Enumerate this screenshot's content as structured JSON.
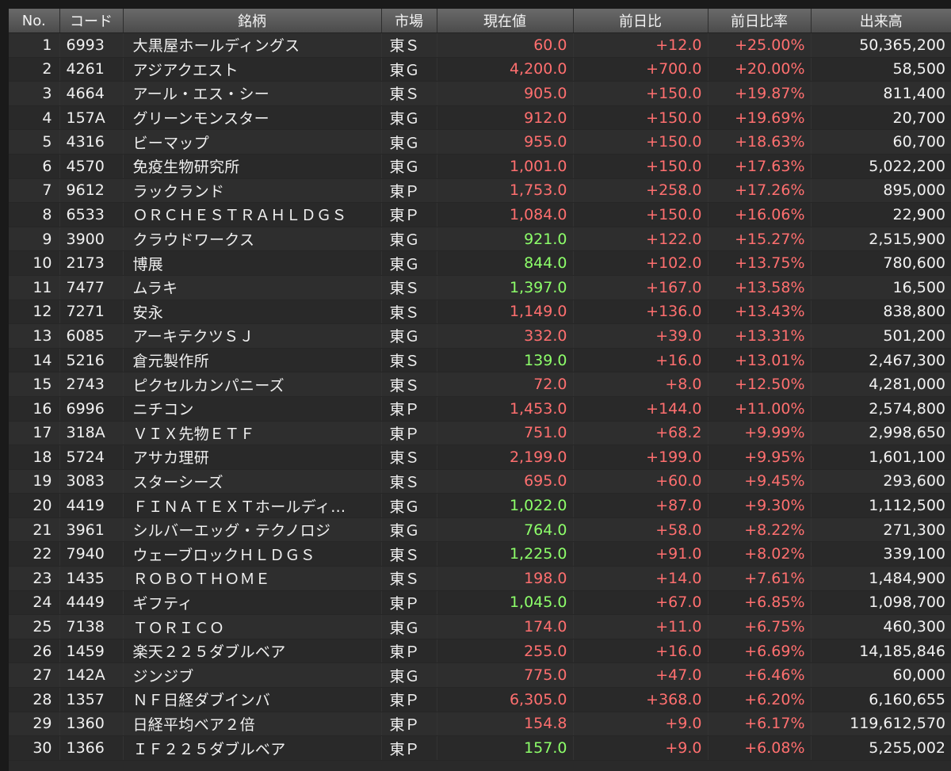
{
  "colors": {
    "up": "#ff6f6f",
    "highlight_up": "#8dff6a",
    "text": "#f0f0f0",
    "header_bg": "#5a5a5a"
  },
  "headers": {
    "no": "No.",
    "code": "コード",
    "name": "銘柄",
    "market": "市場",
    "price": "現在値",
    "change": "前日比",
    "rate": "前日比率",
    "volume": "出来高"
  },
  "rows": [
    {
      "no": "1",
      "code": "6993",
      "name": "大黒屋ホールディングス",
      "market": "東Ｓ",
      "price": "60.0",
      "price_color": "red",
      "change": "+12.0",
      "rate": "+25.00%",
      "volume": "50,365,200"
    },
    {
      "no": "2",
      "code": "4261",
      "name": "アジアクエスト",
      "market": "東Ｇ",
      "price": "4,200.0",
      "price_color": "red",
      "change": "+700.0",
      "rate": "+20.00%",
      "volume": "58,500"
    },
    {
      "no": "3",
      "code": "4664",
      "name": "アール・エス・シー",
      "market": "東Ｓ",
      "price": "905.0",
      "price_color": "red",
      "change": "+150.0",
      "rate": "+19.87%",
      "volume": "811,400"
    },
    {
      "no": "4",
      "code": "157A",
      "name": "グリーンモンスター",
      "market": "東Ｇ",
      "price": "912.0",
      "price_color": "red",
      "change": "+150.0",
      "rate": "+19.69%",
      "volume": "20,700"
    },
    {
      "no": "5",
      "code": "4316",
      "name": "ビーマップ",
      "market": "東Ｇ",
      "price": "955.0",
      "price_color": "red",
      "change": "+150.0",
      "rate": "+18.63%",
      "volume": "60,700"
    },
    {
      "no": "6",
      "code": "4570",
      "name": "免疫生物研究所",
      "market": "東Ｇ",
      "price": "1,001.0",
      "price_color": "red",
      "change": "+150.0",
      "rate": "+17.63%",
      "volume": "5,022,200"
    },
    {
      "no": "7",
      "code": "9612",
      "name": "ラックランド",
      "market": "東Ｐ",
      "price": "1,753.0",
      "price_color": "red",
      "change": "+258.0",
      "rate": "+17.26%",
      "volume": "895,000"
    },
    {
      "no": "8",
      "code": "6533",
      "name": "ＯＲＣＨＥＳＴＲＡＨＬＤＧＳ",
      "market": "東Ｐ",
      "price": "1,084.0",
      "price_color": "red",
      "change": "+150.0",
      "rate": "+16.06%",
      "volume": "22,900"
    },
    {
      "no": "9",
      "code": "3900",
      "name": "クラウドワークス",
      "market": "東Ｇ",
      "price": "921.0",
      "price_color": "green",
      "change": "+122.0",
      "rate": "+15.27%",
      "volume": "2,515,900"
    },
    {
      "no": "10",
      "code": "2173",
      "name": "博展",
      "market": "東Ｇ",
      "price": "844.0",
      "price_color": "green",
      "change": "+102.0",
      "rate": "+13.75%",
      "volume": "780,600"
    },
    {
      "no": "11",
      "code": "7477",
      "name": "ムラキ",
      "market": "東Ｓ",
      "price": "1,397.0",
      "price_color": "green",
      "change": "+167.0",
      "rate": "+13.58%",
      "volume": "16,500"
    },
    {
      "no": "12",
      "code": "7271",
      "name": "安永",
      "market": "東Ｓ",
      "price": "1,149.0",
      "price_color": "red",
      "change": "+136.0",
      "rate": "+13.43%",
      "volume": "838,800"
    },
    {
      "no": "13",
      "code": "6085",
      "name": "アーキテクツＳＪ",
      "market": "東Ｇ",
      "price": "332.0",
      "price_color": "red",
      "change": "+39.0",
      "rate": "+13.31%",
      "volume": "501,200"
    },
    {
      "no": "14",
      "code": "5216",
      "name": "倉元製作所",
      "market": "東Ｓ",
      "price": "139.0",
      "price_color": "green",
      "change": "+16.0",
      "rate": "+13.01%",
      "volume": "2,467,300"
    },
    {
      "no": "15",
      "code": "2743",
      "name": "ピクセルカンパニーズ",
      "market": "東Ｓ",
      "price": "72.0",
      "price_color": "red",
      "change": "+8.0",
      "rate": "+12.50%",
      "volume": "4,281,000"
    },
    {
      "no": "16",
      "code": "6996",
      "name": "ニチコン",
      "market": "東Ｐ",
      "price": "1,453.0",
      "price_color": "red",
      "change": "+144.0",
      "rate": "+11.00%",
      "volume": "2,574,800"
    },
    {
      "no": "17",
      "code": "318A",
      "name": "ＶＩＸ先物ＥＴＦ",
      "market": "東Ｐ",
      "price": "751.0",
      "price_color": "red",
      "change": "+68.2",
      "rate": "+9.99%",
      "volume": "2,998,650"
    },
    {
      "no": "18",
      "code": "5724",
      "name": "アサカ理研",
      "market": "東Ｓ",
      "price": "2,199.0",
      "price_color": "red",
      "change": "+199.0",
      "rate": "+9.95%",
      "volume": "1,601,100"
    },
    {
      "no": "19",
      "code": "3083",
      "name": "スターシーズ",
      "market": "東Ｓ",
      "price": "695.0",
      "price_color": "red",
      "change": "+60.0",
      "rate": "+9.45%",
      "volume": "293,600"
    },
    {
      "no": "20",
      "code": "4419",
      "name": "ＦＩＮＡＴＥＸＴホールディ…",
      "market": "東Ｇ",
      "price": "1,022.0",
      "price_color": "green",
      "change": "+87.0",
      "rate": "+9.30%",
      "volume": "1,112,500"
    },
    {
      "no": "21",
      "code": "3961",
      "name": "シルバーエッグ・テクノロジ",
      "market": "東Ｇ",
      "price": "764.0",
      "price_color": "green",
      "change": "+58.0",
      "rate": "+8.22%",
      "volume": "271,300"
    },
    {
      "no": "22",
      "code": "7940",
      "name": "ウェーブロックＨＬＤＧＳ",
      "market": "東Ｓ",
      "price": "1,225.0",
      "price_color": "green",
      "change": "+91.0",
      "rate": "+8.02%",
      "volume": "339,100"
    },
    {
      "no": "23",
      "code": "1435",
      "name": "ＲＯＢＯＴＨＯＭＥ",
      "market": "東Ｓ",
      "price": "198.0",
      "price_color": "red",
      "change": "+14.0",
      "rate": "+7.61%",
      "volume": "1,484,900"
    },
    {
      "no": "24",
      "code": "4449",
      "name": "ギフティ",
      "market": "東Ｐ",
      "price": "1,045.0",
      "price_color": "green",
      "change": "+67.0",
      "rate": "+6.85%",
      "volume": "1,098,700"
    },
    {
      "no": "25",
      "code": "7138",
      "name": "ＴＯＲＩＣＯ",
      "market": "東Ｇ",
      "price": "174.0",
      "price_color": "red",
      "change": "+11.0",
      "rate": "+6.75%",
      "volume": "460,300"
    },
    {
      "no": "26",
      "code": "1459",
      "name": "楽天２２５ダブルベア",
      "market": "東Ｐ",
      "price": "255.0",
      "price_color": "red",
      "change": "+16.0",
      "rate": "+6.69%",
      "volume": "14,185,846"
    },
    {
      "no": "27",
      "code": "142A",
      "name": "ジンジブ",
      "market": "東Ｇ",
      "price": "775.0",
      "price_color": "red",
      "change": "+47.0",
      "rate": "+6.46%",
      "volume": "60,000"
    },
    {
      "no": "28",
      "code": "1357",
      "name": "ＮＦ日経ダブインバ",
      "market": "東Ｐ",
      "price": "6,305.0",
      "price_color": "red",
      "change": "+368.0",
      "rate": "+6.20%",
      "volume": "6,160,655"
    },
    {
      "no": "29",
      "code": "1360",
      "name": "日経平均ベア２倍",
      "market": "東Ｐ",
      "price": "154.8",
      "price_color": "red",
      "change": "+9.0",
      "rate": "+6.17%",
      "volume": "119,612,570"
    },
    {
      "no": "30",
      "code": "1366",
      "name": "ＩＦ２２５ダブルベア",
      "market": "東Ｐ",
      "price": "157.0",
      "price_color": "green",
      "change": "+9.0",
      "rate": "+6.08%",
      "volume": "5,255,002"
    }
  ]
}
